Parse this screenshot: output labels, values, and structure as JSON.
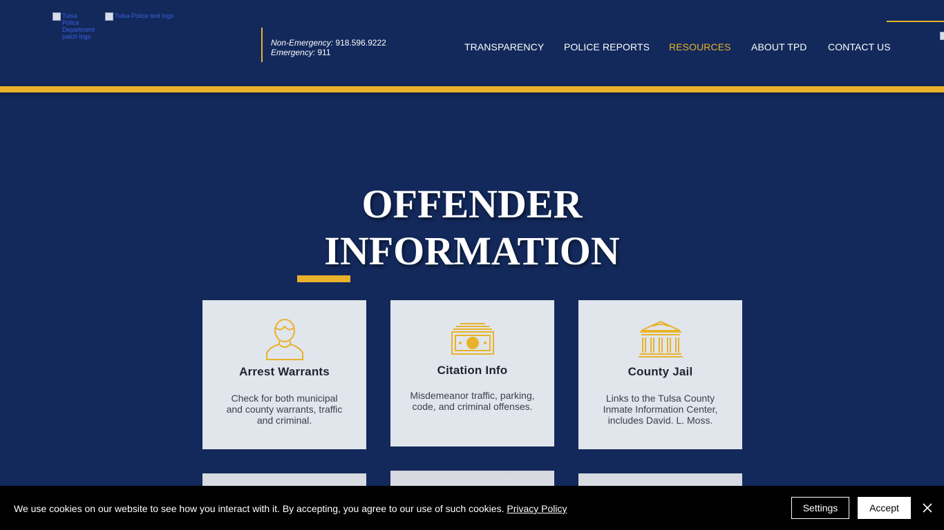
{
  "header": {
    "logos": [
      {
        "alt": "Tulsa Police Department patch logo"
      },
      {
        "alt": "Tulsa Police text logo"
      }
    ],
    "phones": {
      "non_emergency_label": "Non-Emergency:",
      "non_emergency_number": "918.596.9222",
      "emergency_label": "Emergency:",
      "emergency_number": "911"
    },
    "nav": [
      {
        "label": "TRANSPARENCY"
      },
      {
        "label": "POLICE REPORTS"
      },
      {
        "label": "RESOURCES",
        "active": true
      },
      {
        "label": "ABOUT TPD"
      },
      {
        "label": "CONTACT US"
      }
    ]
  },
  "main": {
    "title_line1": "OFFENDER",
    "title_line2": "INFORMATION",
    "cards": [
      {
        "icon": "person-icon",
        "title": "Arrest Warrants",
        "description": "Check for both municipal and county warrants, traffic and criminal."
      },
      {
        "icon": "money-icon",
        "title": "Citation Info",
        "description": "Misdemeanor traffic, parking, code, and criminal offenses."
      },
      {
        "icon": "courthouse-icon",
        "title": "County Jail",
        "description": "Links to the Tulsa County Inmate Information Center, includes David. L. Moss."
      }
    ]
  },
  "cookie": {
    "text": "We use cookies on our website to see how you interact with it. By accepting, you agree to our use of such cookies.",
    "policy_link": "Privacy Policy",
    "settings_label": "Settings",
    "accept_label": "Accept"
  },
  "colors": {
    "navy": "#13295b",
    "gold": "#e8b32a",
    "card_bg": "#e1e5ec"
  }
}
